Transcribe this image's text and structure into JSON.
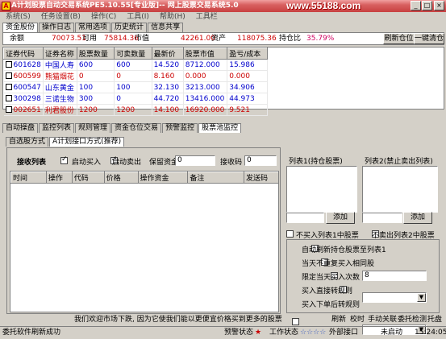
{
  "window": {
    "title": "A计划股票自动交易系统PE5.10.55[专业版]-- 网上股票交易系统5.0",
    "watermark": "www.55188.com",
    "min": "_",
    "max": "□",
    "close": "×",
    "icon_letter": "A"
  },
  "menu": [
    "系统(S)",
    "任务设置(B)",
    "操作(C)",
    "工具(I)",
    "帮助(H)",
    "工具栏"
  ],
  "account_tabs": [
    "资金股份",
    "操作日志",
    "常用选项",
    "历史统计",
    "信息共享"
  ],
  "summary": {
    "balance_label": "余额",
    "balance": "70073.51",
    "available_label": "可用",
    "available": "75814.36",
    "market_value_label": "市值",
    "market_value": "42261.00",
    "assets_label": "资产",
    "assets": "118075.36",
    "position_ratio_label": "持仓比",
    "position_ratio": "35.79%",
    "refresh_button": "刷新仓位",
    "one_click_sell_button": "一键清仓"
  },
  "holdings": {
    "columns": [
      "证券代码",
      "证券名称",
      "股票数量",
      "可卖数量",
      "最新价",
      "股票市值",
      "盈亏/成本"
    ],
    "rows": [
      {
        "code": "601628",
        "name": "中国人寿",
        "qty": "600",
        "sellable": "600",
        "price": "14.520",
        "value": "8712.000",
        "pl": "15.986",
        "color": "blue"
      },
      {
        "code": "600599",
        "name": "熊猫烟花",
        "qty": "0",
        "sellable": "0",
        "price": "8.160",
        "value": "0.000",
        "pl": "0.000",
        "color": "red"
      },
      {
        "code": "600547",
        "name": "山东黄金",
        "qty": "100",
        "sellable": "100",
        "price": "32.130",
        "value": "3213.000",
        "pl": "34.906",
        "color": "blue"
      },
      {
        "code": "300298",
        "name": "三诺生物",
        "qty": "300",
        "sellable": "0",
        "price": "44.720",
        "value": "13416.000",
        "pl": "44.973",
        "color": "blue"
      },
      {
        "code": "002651",
        "name": "利君股份",
        "qty": "1200",
        "sellable": "1200",
        "price": "14.100",
        "value": "16920.000",
        "pl": "9.521",
        "color": "red"
      }
    ]
  },
  "function_tabs": [
    "自动操盘",
    "监控列表",
    "规则管理",
    "资金仓位交易",
    "预警监控",
    "股票池监控"
  ],
  "sub_tabs": [
    "自选股方式",
    "A计划接口方式(推荐)"
  ],
  "controls": {
    "receive_list_label": "接收列表",
    "auto_buy_label": "启动买入",
    "auto_sell_label": "启动卖出",
    "reserve_funds_label": "保留资金",
    "reserve_funds_value": "0",
    "receive_code_label": "接收码",
    "receive_code_value": "0"
  },
  "orders": {
    "columns": [
      "时间",
      "操作",
      "代码",
      "价格",
      "操作资金",
      "备注",
      "发送码"
    ]
  },
  "right": {
    "list1_label": "列表1(持仓股票)",
    "list2_label": "列表2(禁止卖出列表)",
    "add_button": "添加",
    "no_buy_list1_label": "不买入列表1中股票",
    "no_sell_list2_label": "不卖出列表2中股票",
    "auto_refresh_label": "自动刷新持仓股票至列表1",
    "no_repeat_label": "当天不重复买入相同股",
    "limit_buys_label": "限定当天买入次数",
    "limit_buys_value": "8",
    "buy_rule_label": "买入直接转规则",
    "sell_rule_label": "买入下单后转规则"
  },
  "marquee": "我们欢迎市场下跌, 因为它使我们能以更便宜价格买到更多的股票",
  "status": {
    "left": "委托软件刷新成功",
    "warning_label": "预警状态",
    "work_label": "工作状态",
    "interface_label": "外部接口",
    "not_started": "未启动",
    "time": "15:24:05",
    "stars": "☆☆☆☆",
    "warning_star": "★"
  },
  "right_menu": [
    "刷新",
    "校时",
    "手动关联",
    "委托检测",
    "托盘"
  ]
}
